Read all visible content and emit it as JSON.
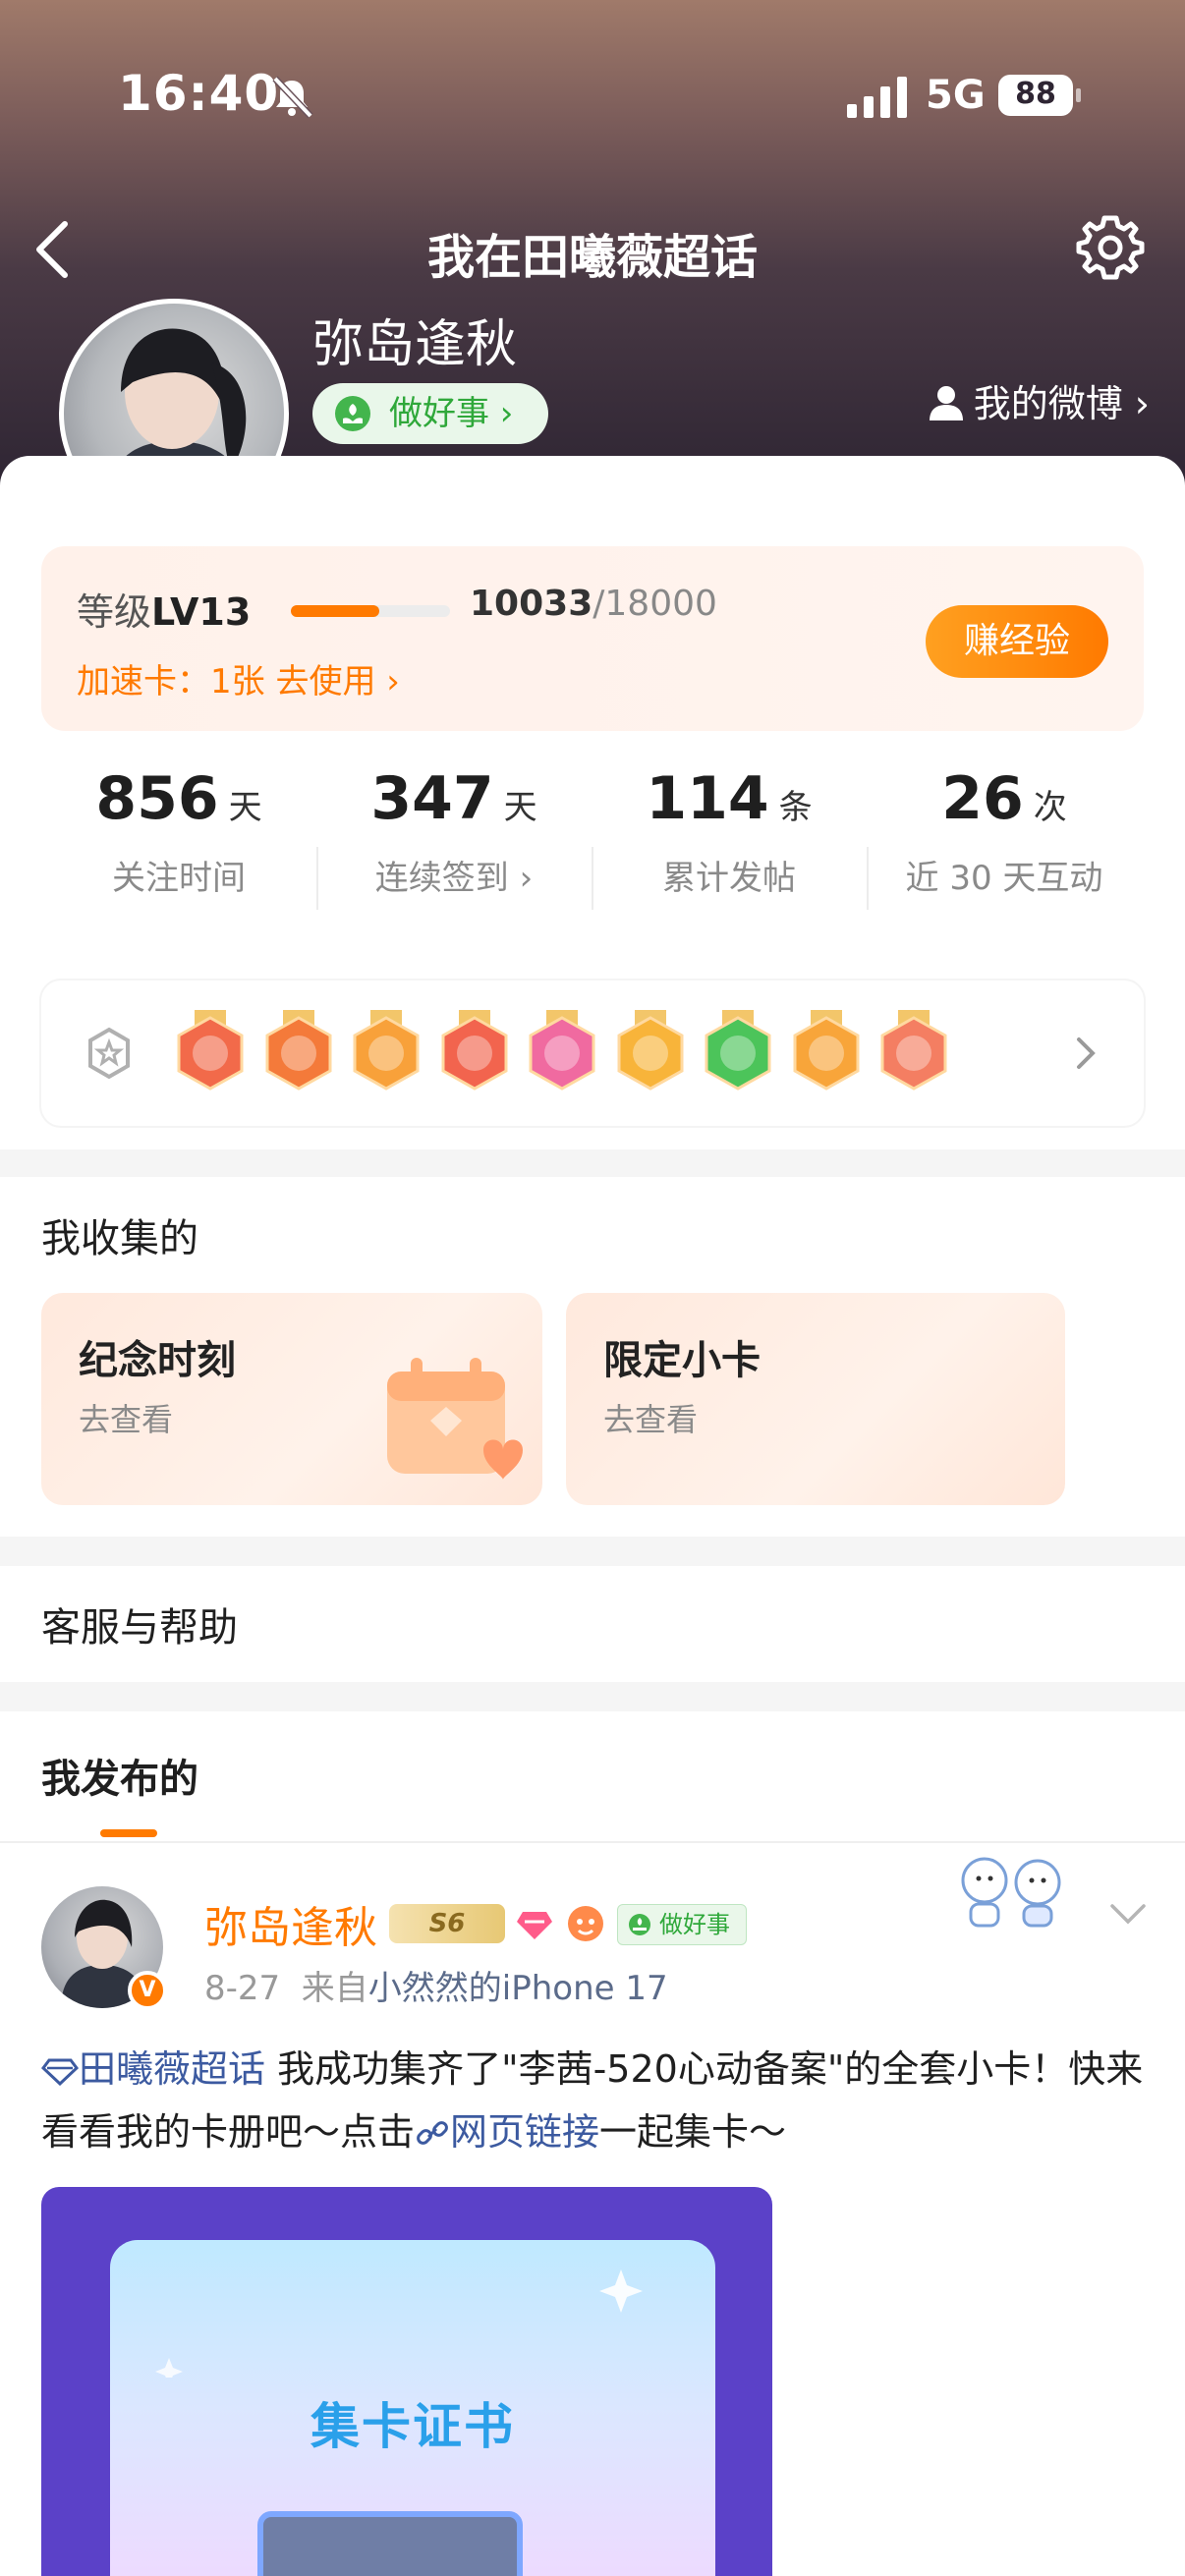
{
  "status_bar": {
    "time": "16:40",
    "network": "5G",
    "battery": "88"
  },
  "nav": {
    "title": "我在田曦薇超话"
  },
  "profile": {
    "username": "弥岛逢秋",
    "good_deed_chip": "做好事 ›",
    "my_weibo": "我的微博 ›",
    "verified_badge": "V"
  },
  "level": {
    "label_prefix": "等级",
    "level": "LV13",
    "score_current": "10033",
    "score_total": "/18000",
    "progress_fraction": 0.557,
    "boost_card": "加速卡：1张 去使用 ›",
    "earn_button": "赚经验"
  },
  "stats": [
    {
      "value": "856",
      "unit": "天",
      "label": "关注时间"
    },
    {
      "value": "347",
      "unit": "天",
      "label": "连续签到 ›"
    },
    {
      "value": "114",
      "unit": "条",
      "label": "累计发帖"
    },
    {
      "value": "26",
      "unit": "次",
      "label": "近 30 天互动"
    }
  ],
  "medals": [
    {
      "icon": "cat-medal-icon",
      "color": "#f26a4a"
    },
    {
      "icon": "100-days-medal-icon",
      "color": "#f47a3a"
    },
    {
      "icon": "crown-medal-icon",
      "color": "#f8a13a"
    },
    {
      "icon": "mascot-medal-icon",
      "color": "#f2644e"
    },
    {
      "icon": "lv13-medal-icon",
      "color": "#f06aa0"
    },
    {
      "icon": "hi-medal-icon",
      "color": "#f8b43a"
    },
    {
      "icon": "hand-medal-icon",
      "color": "#4cc45a"
    },
    {
      "icon": "30-days-medal-icon",
      "color": "#f8a53a"
    },
    {
      "icon": "gesture-medal-icon",
      "color": "#f47e62"
    }
  ],
  "collect_section": {
    "title": "我收集的",
    "cards": [
      {
        "title": "纪念时刻",
        "subtitle": "去查看"
      },
      {
        "title": "限定小卡",
        "subtitle": "去查看"
      }
    ]
  },
  "help": {
    "label": "客服与帮助"
  },
  "posts_tab": {
    "label": "我发布的"
  },
  "post": {
    "author": "弥岛逢秋",
    "badge_s6": "S6",
    "chip": "做好事",
    "meta_date": "8-27",
    "meta_from": "来自",
    "meta_device": "小然然的iPhone 17",
    "topic_tag": "田曦薇超话",
    "text_1": "我成功集齐了\"李茜-520心动备案\"的全套小卡！快来看看我的卡册吧～点击",
    "link_text": "网页链接",
    "text_2": "一起集卡～",
    "image_title": "集卡证书"
  },
  "colors": {
    "accent": "#ff7a00",
    "link": "#3c5aa0",
    "green": "#2fa83a"
  }
}
